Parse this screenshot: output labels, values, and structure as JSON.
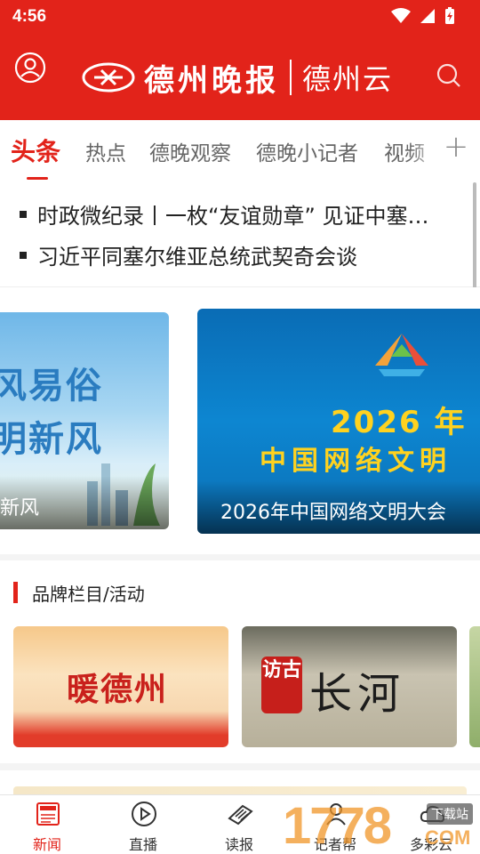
{
  "status_bar": {
    "time": "4:56"
  },
  "header": {
    "logo_main": "德州晚报",
    "logo_sub": "德州云",
    "colors": {
      "brand_red": "#e2231a"
    }
  },
  "tabs": [
    {
      "label": "头条",
      "active": true
    },
    {
      "label": "热点"
    },
    {
      "label": "德晚观察"
    },
    {
      "label": "德晚小记者"
    },
    {
      "label": "视频"
    }
  ],
  "tab_add": "+",
  "headlines": [
    "时政微纪录丨一枚“友谊勋章” 见证中塞…",
    "习近平同塞尔维亚总统武契奇会谈"
  ],
  "carousel": [
    {
      "big1": "风易俗",
      "big2": "明新风",
      "caption": "新风"
    },
    {
      "year": "2026 年",
      "big": "中国网络文明",
      "caption": "2026年中国网络文明大会"
    }
  ],
  "brand": {
    "title": "品牌栏目/活动",
    "cards": [
      {
        "title": "暖德州"
      },
      {
        "seal": "访古",
        "title": "长河"
      }
    ]
  },
  "bottom_nav": [
    {
      "label": "新闻",
      "icon": "news-icon",
      "active": true
    },
    {
      "label": "直播",
      "icon": "play-icon"
    },
    {
      "label": "读报",
      "icon": "newspaper-icon"
    },
    {
      "label": "记者帮",
      "icon": "reporter-icon"
    },
    {
      "label": "多彩云",
      "icon": "cloud-icon"
    }
  ],
  "watermark": {
    "num": "1778",
    "badge": "下载站",
    "com": "COM"
  }
}
